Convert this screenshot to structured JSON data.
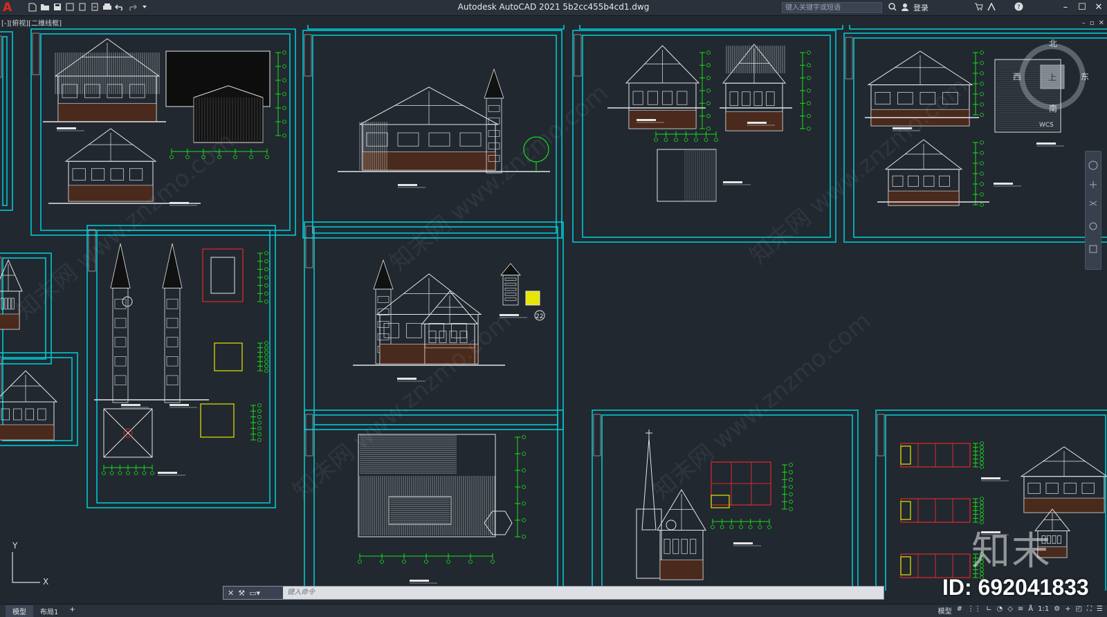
{
  "app": {
    "logo": "A",
    "title": "Autodesk AutoCAD 2021    5b2cc455b4cd1.dwg"
  },
  "search": {
    "placeholder": "键入关键字或短语"
  },
  "account": {
    "signin": "登录"
  },
  "viewport": {
    "label": "[-][俯视][二维线框]"
  },
  "viewcube": {
    "north": "北",
    "south": "南",
    "east": "东",
    "west": "西",
    "top": "上",
    "wcs": "WCS"
  },
  "ucs": {
    "x": "X",
    "y": "Y"
  },
  "command": {
    "placeholder": "键入命令"
  },
  "tabs": [
    "模型",
    "布局1"
  ],
  "status": {
    "model": "模型",
    "scale": "1:1"
  },
  "drawing": {
    "detail_number": "22"
  },
  "watermark": {
    "brand": "知末",
    "id": "ID: 692041833",
    "site_text": "知末网 www.znzmo.com"
  },
  "colors": {
    "background": "#212830",
    "frame": "#00c8d2",
    "linework": "#e6e6e6",
    "dimension": "#19e019",
    "highlight": "#e6e600",
    "red": "#e02a2a"
  }
}
